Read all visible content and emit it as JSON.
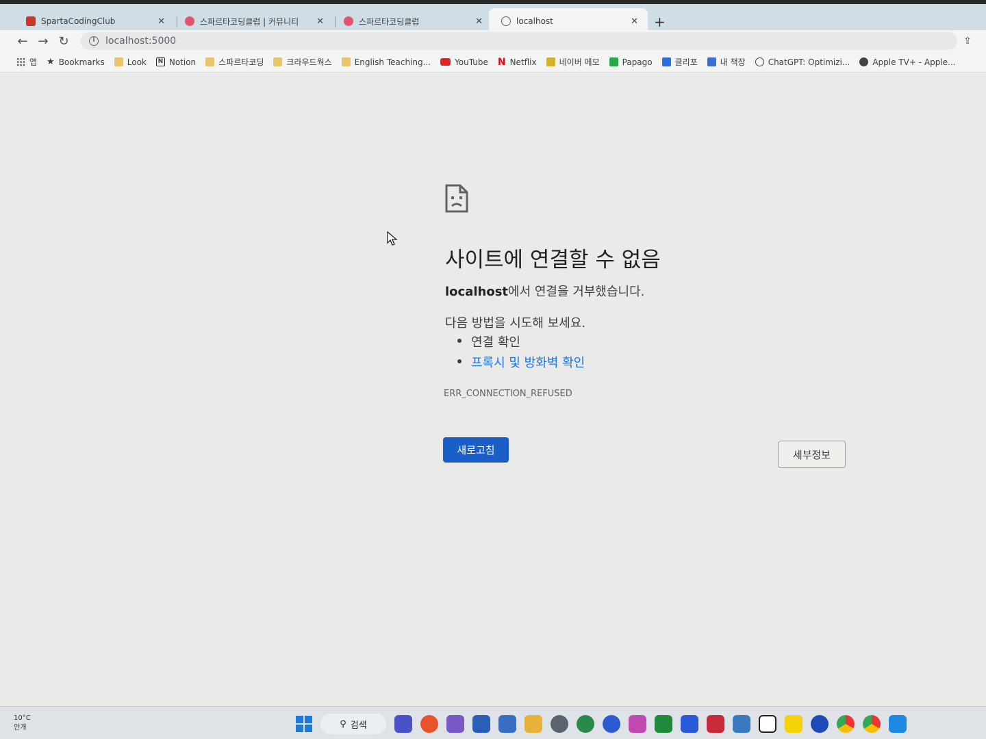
{
  "tabs": [
    {
      "title": "SpartaCodingClub",
      "favicon_color": "#c0392b",
      "active": false
    },
    {
      "title": "스파르타코딩클럽 | 커뮤니티",
      "favicon_color": "#e0566e",
      "active": false
    },
    {
      "title": "스파르타코딩클럽",
      "favicon_color": "#e0566e",
      "active": false
    },
    {
      "title": "localhost",
      "favicon_color": "#5f6368",
      "active": true
    }
  ],
  "new_tab_label": "+",
  "toolbar": {
    "url": "localhost:5000"
  },
  "bookmarks": [
    {
      "label": "앱",
      "icon": "apps-icon"
    },
    {
      "label": "Bookmarks",
      "icon": "star-icon"
    },
    {
      "label": "Look",
      "icon": "folder-icon"
    },
    {
      "label": "Notion",
      "icon": "notion-icon"
    },
    {
      "label": "스파르타코딩",
      "icon": "folder-icon"
    },
    {
      "label": "크라우드웍스",
      "icon": "folder-icon"
    },
    {
      "label": "English Teaching...",
      "icon": "folder-icon"
    },
    {
      "label": "YouTube",
      "icon": "youtube-icon"
    },
    {
      "label": "Netflix",
      "icon": "netflix-icon"
    },
    {
      "label": "네이버 메모",
      "icon": "memo-icon"
    },
    {
      "label": "Papago",
      "icon": "papago-icon"
    },
    {
      "label": "클리포",
      "icon": "clipo-icon"
    },
    {
      "label": "내 책장",
      "icon": "bookshelf-icon"
    },
    {
      "label": "ChatGPT: Optimizi...",
      "icon": "chatgpt-icon"
    },
    {
      "label": "Apple TV+ - Apple...",
      "icon": "apple-icon"
    }
  ],
  "error": {
    "title": "사이트에 연결할 수 없음",
    "host": "localhost",
    "desc_suffix": "에서 연결을 거부했습니다.",
    "try_label": "다음 방법을 시도해 보세요.",
    "suggestions": [
      "연결 확인",
      "프록시 및 방화벽 확인"
    ],
    "code": "ERR_CONNECTION_REFUSED",
    "reload_label": "새로고침",
    "details_label": "세부정보"
  },
  "taskbar": {
    "temperature": "10°C",
    "weather": "안개",
    "search_label": "검색",
    "accent": "#1e7ad8"
  }
}
